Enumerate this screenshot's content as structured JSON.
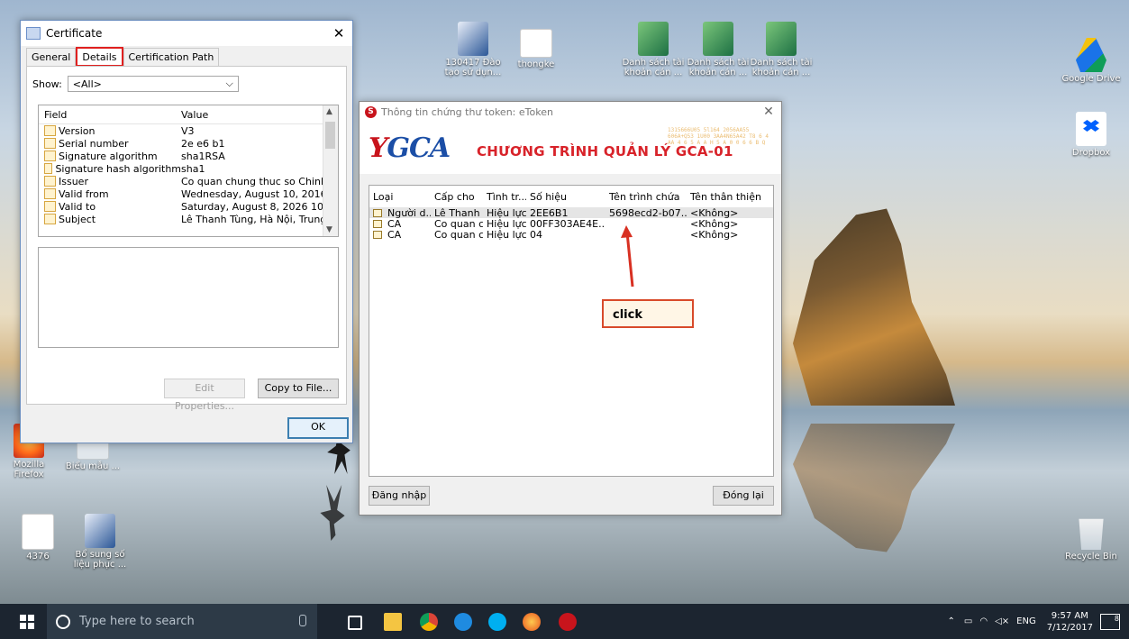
{
  "desktop": {
    "icons": [
      {
        "label": "130417 Đào tạo sử dụn...",
        "type": "word"
      },
      {
        "label": "thongke",
        "type": "file"
      },
      {
        "label": "Danh sách tài khoản cán ...",
        "type": "excel"
      },
      {
        "label": "Danh sách tài khoản cán ...",
        "type": "excel"
      },
      {
        "label": "Danh sách tài khoản cán ...",
        "type": "excel"
      },
      {
        "label": "Google Drive",
        "type": "gdrive"
      },
      {
        "label": "Dropbox",
        "type": "dropbox"
      },
      {
        "label": "Mozilla Firefox",
        "type": "firefox"
      },
      {
        "label": "Biểu mẫu ...",
        "type": "file"
      },
      {
        "label": "4376",
        "type": "doc"
      },
      {
        "label": "Bổ sung số liệu phục ...",
        "type": "word"
      },
      {
        "label": "Recycle Bin",
        "type": "recycle"
      }
    ]
  },
  "certificate": {
    "title": "Certificate",
    "tabs": [
      "General",
      "Details",
      "Certification Path"
    ],
    "active_tab": "Details",
    "show_label": "Show:",
    "show_value": "<All>",
    "columns": [
      "Field",
      "Value"
    ],
    "rows": [
      {
        "field": "Version",
        "value": "V3"
      },
      {
        "field": "Serial number",
        "value": "2e e6 b1"
      },
      {
        "field": "Signature algorithm",
        "value": "sha1RSA"
      },
      {
        "field": "Signature hash algorithm",
        "value": "sha1"
      },
      {
        "field": "Issuer",
        "value": "Co quan chung thuc so Chinh ..."
      },
      {
        "field": "Valid from",
        "value": "Wednesday, August 10, 2016 ..."
      },
      {
        "field": "Valid to",
        "value": "Saturday, August 8, 2026 10:..."
      },
      {
        "field": "Subject",
        "value": "Lê Thanh Tùng, Hà Nội, Trung..."
      }
    ],
    "edit_properties_label": "Edit Properties...",
    "copy_to_file_label": "Copy to File...",
    "ok_label": "OK"
  },
  "token_window": {
    "title": "Thông tin chứng thư token: eToken",
    "logo_text": "GCA",
    "banner_title": "CHƯƠNG TRÌNH QUẢN LÝ GCA-01",
    "columns": [
      "Loại",
      "Cấp cho",
      "Tình tr...",
      "Số hiệu",
      "Tên trình chứa",
      "Tên thân thiện"
    ],
    "rows": [
      {
        "type": "Người d...",
        "issued_to": "Lê Thanh ...",
        "status": "Hiệu lực",
        "serial": "2EE6B1",
        "container": "5698ecd2-b07...",
        "friendly": "<Không>",
        "selected": true
      },
      {
        "type": "CA",
        "issued_to": "Co quan c...",
        "status": "Hiệu lực",
        "serial": "00FF303AE4E...",
        "container": "",
        "friendly": "<Không>",
        "selected": false
      },
      {
        "type": "CA",
        "issued_to": "Co quan c...",
        "status": "Hiệu lực",
        "serial": "04",
        "container": "",
        "friendly": "<Không>",
        "selected": false
      }
    ],
    "login_label": "Đăng nhập",
    "close_label": "Đóng lại"
  },
  "annotation": {
    "text": "click",
    "color": "#d84a2a"
  },
  "taskbar": {
    "search_placeholder": "Type here to search",
    "language": "ENG",
    "time": "9:57 AM",
    "date": "7/12/2017",
    "notification_count": "8"
  },
  "colors": {
    "taskbar": "#1c2530",
    "accent_red": "#e0201f",
    "gca_blue": "#1b4ea6",
    "gca_red": "#d8232a"
  }
}
